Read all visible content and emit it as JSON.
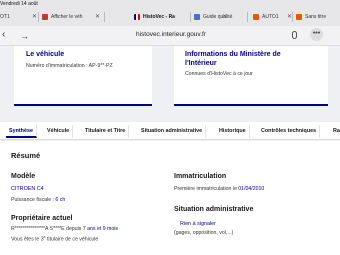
{
  "status": {
    "time": "Vendredi 14 août"
  },
  "browser_tabs": [
    {
      "label": "OT1",
      "favicon_color": "#7b7b80"
    },
    {
      "label": "Afficher le véh",
      "favicon_color": "#c23b2f"
    },
    {
      "label": "HistoVec - Ra",
      "favicon_color": "#000091"
    },
    {
      "label": "Guide qualité",
      "favicon_color": "#4b6cd0"
    },
    {
      "label": "AUTO1",
      "favicon_color": "#e05a00"
    },
    {
      "label": "Sans titre",
      "favicon_color": "#e05a00"
    }
  ],
  "url_bar": {
    "url": "histovec.interieur.gouv.fr",
    "more": "•••"
  },
  "cards": {
    "vehicle": {
      "title": "Le véhicule",
      "text": "Numéro d'immatriculation : AP-9**-PZ"
    },
    "ministry": {
      "title_line1": "Informations du Ministère de",
      "title_line2": "l'Intérieur",
      "text": "Connues d'HistoVec à ce jour"
    }
  },
  "nav_tabs": [
    "Synthèse",
    "Véhicule",
    "Titulaire et Titre",
    "Situation administrative",
    "Historique",
    "Contrôles techniques",
    "Rap"
  ],
  "summary": {
    "heading": "Résumé",
    "model": {
      "heading": "Modèle",
      "value": "CITROEN C4",
      "power_label": "Puissance fiscale : ",
      "power_value": "6 ch"
    },
    "owner": {
      "heading": "Propriétaire actuel",
      "name_mask": "R***************A S****E",
      "since_label": " depuis ",
      "since_value": "7 ans et 9 mois",
      "rank_text": "Vous êtes le 3",
      "rank_sup": "e",
      "rank_suffix": " titulaire de ce véhicule"
    },
    "registration": {
      "heading": "Immatriculation",
      "first_label": "Première immatriculation le ",
      "first_date": "01/04/2010"
    },
    "admin": {
      "heading": "Situation administrative",
      "value": "Rien à signaler",
      "note": "(gages, opposition, vol,...)"
    }
  },
  "colors": {
    "accent": "#000091"
  }
}
